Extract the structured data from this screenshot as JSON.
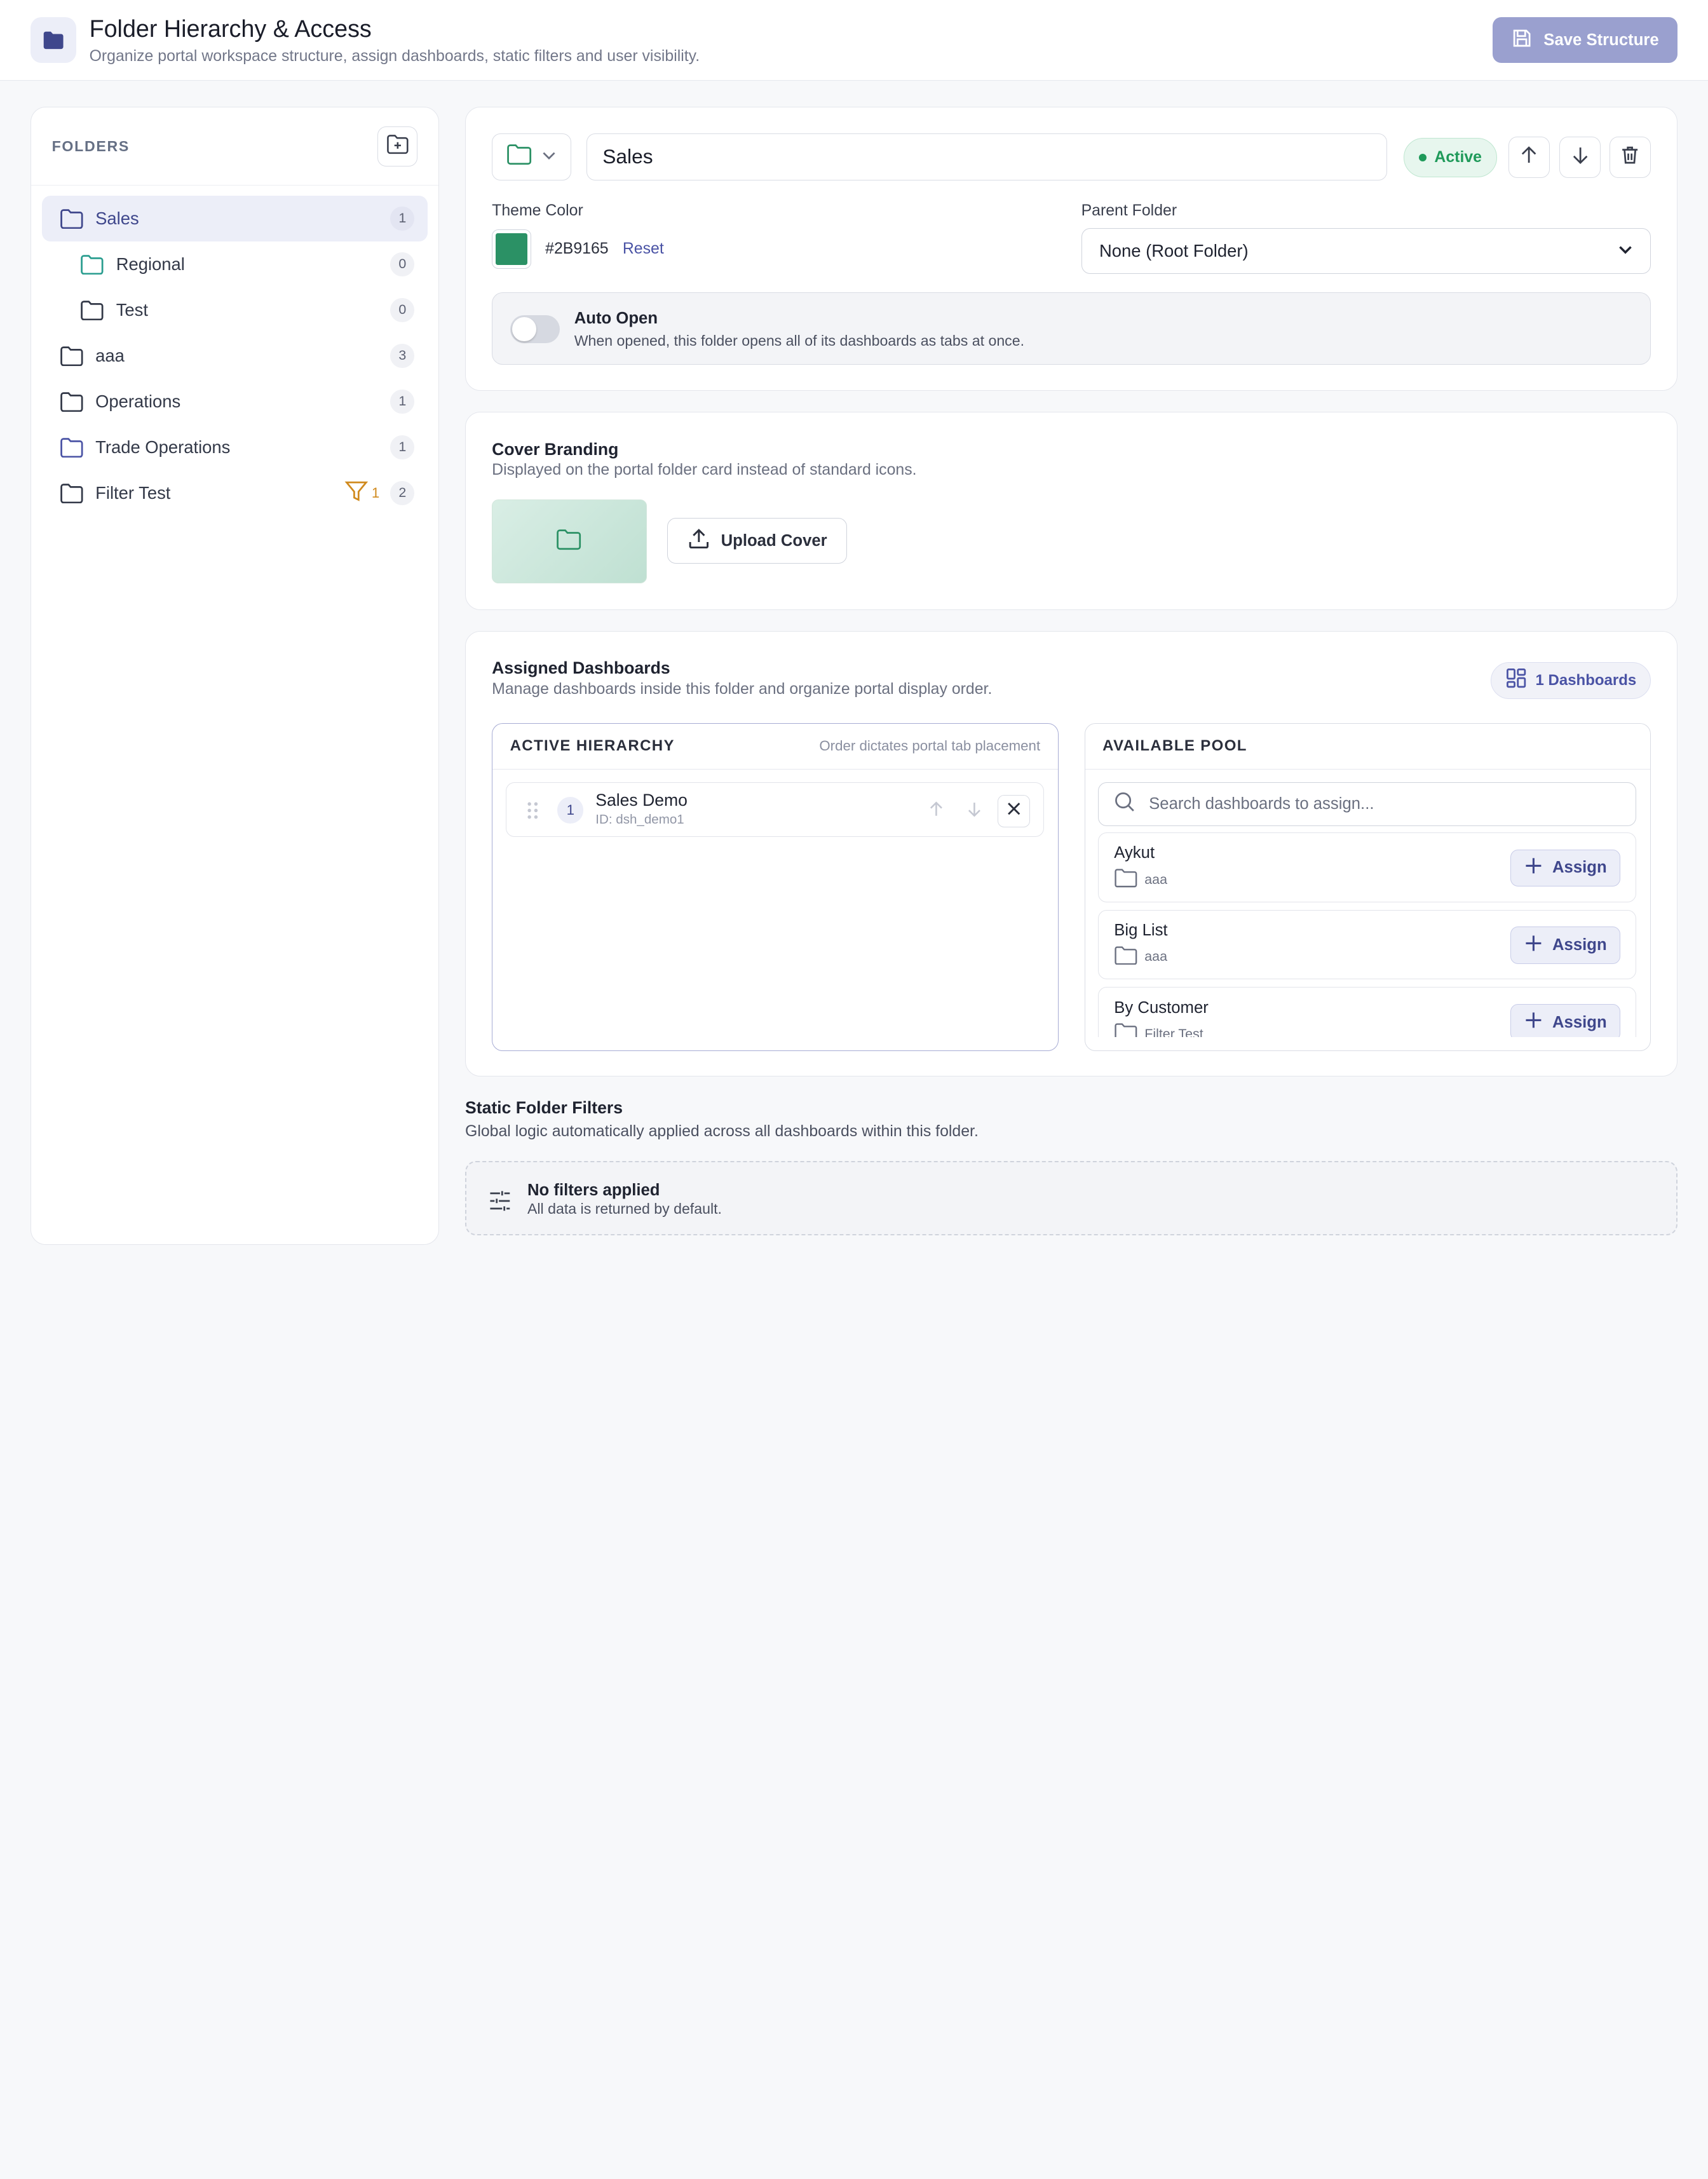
{
  "header": {
    "title": "Folder Hierarchy & Access",
    "subtitle": "Organize portal workspace structure, assign dashboards, static filters and user visibility.",
    "save_label": "Save Structure"
  },
  "sidebar": {
    "heading": "FOLDERS",
    "items": [
      {
        "label": "Sales",
        "count": "1"
      },
      {
        "label": "Regional",
        "count": "0"
      },
      {
        "label": "Test",
        "count": "0"
      },
      {
        "label": "aaa",
        "count": "3"
      },
      {
        "label": "Operations",
        "count": "1"
      },
      {
        "label": "Trade Operations",
        "count": "1"
      },
      {
        "label": "Filter Test",
        "count": "2",
        "filter_count": "1"
      }
    ]
  },
  "folder": {
    "name": "Sales",
    "status": "Active",
    "theme_color_label": "Theme Color",
    "theme_color": "#2B9165",
    "reset_label": "Reset",
    "parent_label": "Parent Folder",
    "parent_value": "None (Root Folder)",
    "auto_open_title": "Auto Open",
    "auto_open_desc": "When opened, this folder opens all of its dashboards as tabs at once."
  },
  "cover": {
    "title": "Cover Branding",
    "subtitle": "Displayed on the portal folder card instead of standard icons.",
    "upload_label": "Upload Cover"
  },
  "assigned": {
    "title": "Assigned Dashboards",
    "subtitle": "Manage dashboards inside this folder and organize portal display order.",
    "count_label": "1 Dashboards",
    "hierarchy_title": "ACTIVE HIERARCHY",
    "hierarchy_hint": "Order dictates portal tab placement",
    "rows": [
      {
        "num": "1",
        "name": "Sales Demo",
        "id": "ID: dsh_demo1"
      }
    ],
    "pool_title": "AVAILABLE POOL",
    "search_placeholder": "Search dashboards to assign...",
    "assign_label": "Assign",
    "pool": [
      {
        "name": "Aykut",
        "folder": "aaa"
      },
      {
        "name": "Big List",
        "folder": "aaa"
      },
      {
        "name": "By Customer",
        "folder": "Filter Test"
      }
    ]
  },
  "filters": {
    "title": "Static Folder Filters",
    "subtitle": "Global logic automatically applied across all dashboards within this folder.",
    "empty_title": "No filters applied",
    "empty_sub": "All data is returned by default."
  },
  "colors": {
    "accent": "#4A53A5",
    "active_green": "#1F9A5A",
    "filter_orange": "#D08A1E"
  }
}
